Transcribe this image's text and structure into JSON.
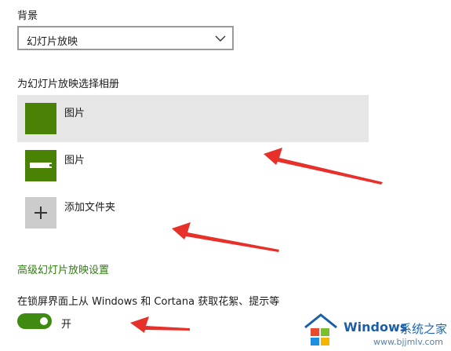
{
  "background": {
    "label": "背景",
    "selected": "幻灯片放映"
  },
  "albums": {
    "heading": "为幻灯片放映选择相册",
    "items": [
      {
        "label": "图片",
        "selected": true
      },
      {
        "label": "图片",
        "selected": false
      }
    ],
    "add_folder_label": "添加文件夹"
  },
  "advanced": {
    "link": "高级幻灯片放映设置"
  },
  "lockscreen_tips": {
    "label": "在锁屏界面上从 Windows 和 Cortana 获取花絮、提示等",
    "toggle_state": "开",
    "on": true
  },
  "watermark": {
    "brand": "Windows",
    "site_name": "系统之家",
    "url": "www.bjjmlv.com"
  },
  "colors": {
    "accent_green": "#498205",
    "arrow_red": "#e8302a"
  }
}
